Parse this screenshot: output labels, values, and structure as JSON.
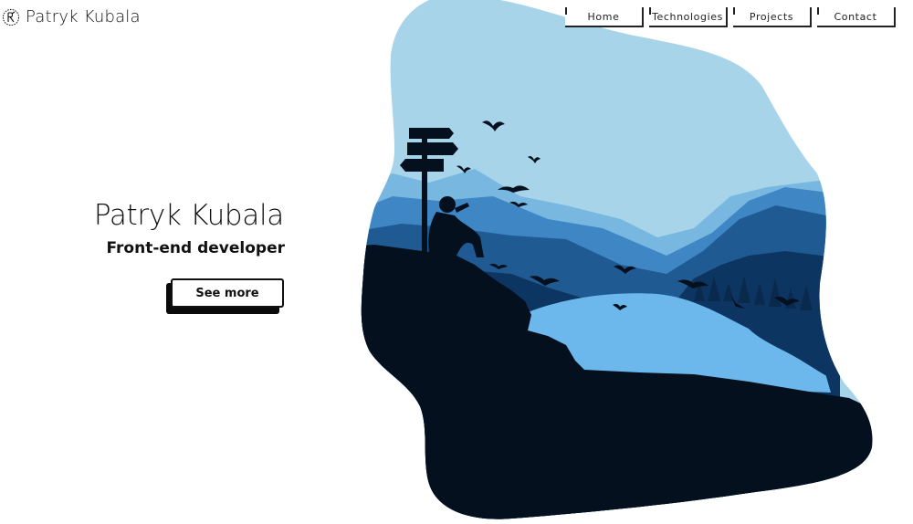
{
  "header": {
    "logo_mark_icon": "pk-monogram-icon",
    "logo_text": "Patryk Kubala"
  },
  "nav": {
    "items": [
      {
        "label": "Home"
      },
      {
        "label": "Technologies"
      },
      {
        "label": "Projects"
      },
      {
        "label": "Contact"
      }
    ]
  },
  "hero": {
    "name": "Patryk Kubala",
    "role": "Front-end developer",
    "cta_label": "See more",
    "illustration_icon": "mountain-lake-hiker-illustration"
  },
  "colors": {
    "text": "#111111",
    "sky": "#a8d4ea",
    "lake": "#6cb8ec",
    "far_mountains": "#3f86c5",
    "mid_mountains": "#1f5a93",
    "near_mountains": "#0d3561",
    "silhouette": "#05101e"
  }
}
